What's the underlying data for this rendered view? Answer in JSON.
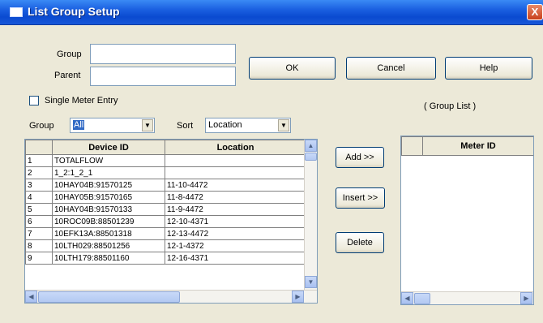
{
  "window": {
    "title": "List Group Setup",
    "close_glyph": "X"
  },
  "form": {
    "group_label": "Group",
    "group_value": "",
    "parent_label": "Parent",
    "parent_value": "",
    "single_meter_label": "Single Meter Entry",
    "single_meter_checked": false,
    "group_filter_label": "Group",
    "group_filter_value": "All",
    "sort_label": "Sort",
    "sort_value": "Location",
    "group_list_label": "( Group List )"
  },
  "buttons": {
    "ok": "OK",
    "cancel": "Cancel",
    "help": "Help",
    "add": "Add >>",
    "insert": "Insert >>",
    "delete": "Delete"
  },
  "device_table": {
    "columns": [
      "",
      "Device ID",
      "Location"
    ],
    "rows": [
      {
        "n": "1",
        "device": "TOTALFLOW",
        "location": ""
      },
      {
        "n": "2",
        "device": "1_2:1_2_1",
        "location": ""
      },
      {
        "n": "3",
        "device": "10HAY04B:91570125",
        "location": "11-10-4472"
      },
      {
        "n": "4",
        "device": "10HAY05B:91570165",
        "location": "11-8-4472"
      },
      {
        "n": "5",
        "device": "10HAY04B:91570133",
        "location": "11-9-4472"
      },
      {
        "n": "6",
        "device": "10ROC09B:88501239",
        "location": "12-10-4371"
      },
      {
        "n": "7",
        "device": "10EFK13A:88501318",
        "location": "12-13-4472"
      },
      {
        "n": "8",
        "device": "10LTH029:88501256",
        "location": "12-1-4372"
      },
      {
        "n": "9",
        "device": "10LTH179:88501160",
        "location": "12-16-4371"
      }
    ]
  },
  "meter_table": {
    "columns": [
      "",
      "Meter ID"
    ]
  },
  "icons": {
    "up": "▲",
    "down": "▼",
    "left": "◀",
    "right": "▶",
    "combo": "▼"
  }
}
